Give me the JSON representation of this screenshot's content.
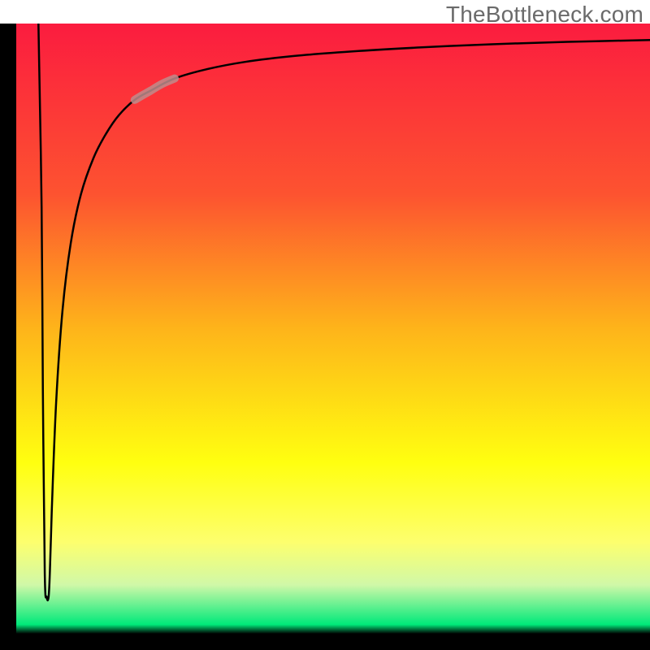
{
  "watermark": "TheBottleneck.com",
  "chart_data": {
    "type": "line",
    "title": "",
    "xlabel": "",
    "ylabel": "",
    "xlim": [
      0,
      100
    ],
    "ylim": [
      0,
      100
    ],
    "grid": false,
    "legend": false,
    "background_gradient_stops": [
      {
        "pct": 0.0,
        "color": "#fb1c3f"
      },
      {
        "pct": 0.28,
        "color": "#fd5330"
      },
      {
        "pct": 0.5,
        "color": "#feb41a"
      },
      {
        "pct": 0.72,
        "color": "#ffff10"
      },
      {
        "pct": 0.85,
        "color": "#fdff6e"
      },
      {
        "pct": 0.92,
        "color": "#d0f8a8"
      },
      {
        "pct": 0.985,
        "color": "#00e97a"
      },
      {
        "pct": 1.0,
        "color": "#000000"
      }
    ],
    "series": [
      {
        "name": "bottleneck-curve",
        "stroke": "#000000",
        "stroke_width": 2.5,
        "x": [
          3.5,
          4.0,
          4.2,
          4.5,
          4.8,
          5.1,
          5.3,
          5.6,
          6.3,
          7.3,
          8.6,
          10.2,
          12.2,
          14.2,
          16.2,
          18.7,
          21.2,
          25,
          30,
          36,
          44,
          54,
          64,
          75,
          87,
          100
        ],
        "values": [
          100,
          70,
          40,
          10,
          6,
          6,
          10,
          20,
          38,
          53,
          64,
          72,
          78,
          82,
          85,
          87.5,
          89,
          91,
          92.5,
          93.7,
          94.7,
          95.5,
          96.1,
          96.6,
          97.0,
          97.3
        ]
      },
      {
        "name": "highlight-segment",
        "stroke": "#be8c8c",
        "stroke_width": 10,
        "x": [
          18.7,
          20.0,
          21.2,
          23.0,
          25.0
        ],
        "values": [
          87.5,
          88.3,
          89.0,
          90.1,
          91.0
        ]
      }
    ],
    "notes": "Values are read off the figure by position; no axis tick labels are present in the image, so x/y are normalized to 0–100 of the plotting area. background_gradient_stops describe the vertical color fill behind the curve."
  }
}
